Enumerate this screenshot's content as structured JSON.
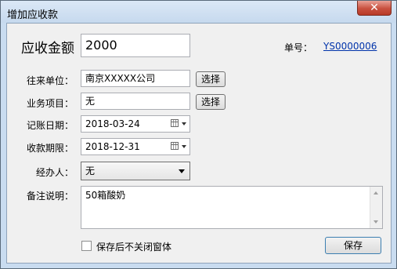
{
  "window": {
    "title": "增加应收款",
    "close_glyph": "✕"
  },
  "amount": {
    "label": "应收金额",
    "value": "2000"
  },
  "order_no": {
    "label": "单号：",
    "value": "YS0000006"
  },
  "partner": {
    "label": "往来单位：",
    "value": "南京XXXXX公司",
    "select_label": "选择"
  },
  "project": {
    "label": "业务项目：",
    "value": "无",
    "select_label": "选择"
  },
  "record_date": {
    "label": "记账日期：",
    "value": "2018-03-24"
  },
  "due_date": {
    "label": "收款期限：",
    "value": "2018-12-31"
  },
  "handler": {
    "label": "经办人：",
    "value": "无"
  },
  "remarks": {
    "label": "备注说明：",
    "value": "50箱酸奶"
  },
  "keep_open": {
    "label": "保存后不关闭窗体",
    "checked": false
  },
  "save_label": "保存",
  "colors": {
    "title_bg": "#c9dcf0",
    "link": "#0033aa",
    "close": "#c8503f"
  }
}
